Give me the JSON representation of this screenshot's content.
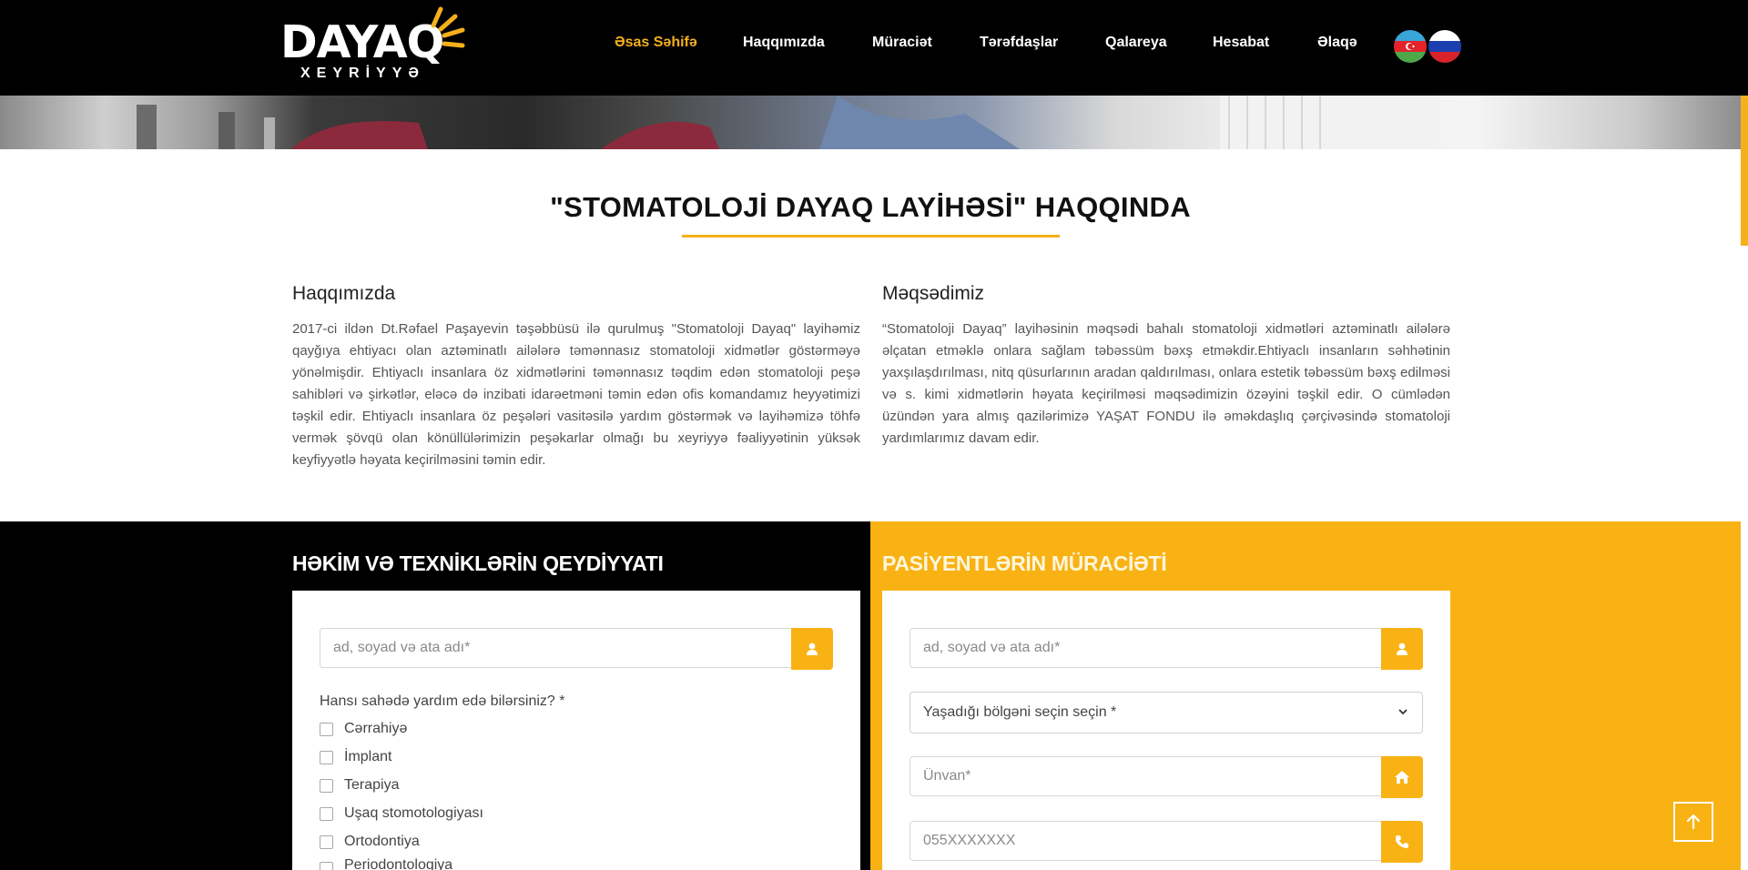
{
  "brand": {
    "name": "DAYAQ",
    "tagline": "XEYRİYYƏ",
    "accent_color": "#f5b01a"
  },
  "nav": {
    "items": [
      {
        "label": "Əsas Səhifə",
        "active": true
      },
      {
        "label": "Haqqımızda",
        "active": false
      },
      {
        "label": "Müraciət",
        "active": false
      },
      {
        "label": "Tərəfdaşlar",
        "active": false
      },
      {
        "label": "Qalareya",
        "active": false
      },
      {
        "label": "Hesabat",
        "active": false
      },
      {
        "label": "Əlaqə",
        "active": false
      }
    ],
    "languages": [
      {
        "icon": "azerbaijan-flag-icon"
      },
      {
        "icon": "russia-flag-icon"
      }
    ]
  },
  "about": {
    "title": "\"STOMATOLOJİ DAYAQ LAYİHƏSİ\" HAQQINDA",
    "left": {
      "heading": "Haqqımızda",
      "text": "2017-ci ildən Dt.Rəfael Paşayevin təşəbbüsü ilə qurulmuş \"Stomatoloji Dayaq\" layihəmiz qayğıya ehtiyacı olan aztəminatlı ailələrə təmənnasız stomatoloji xidmətlər göstərməyə yönəlmişdir. Ehtiyaclı insanlara öz xidmətlərini təmənnasız təqdim edən stomatoloji peşə sahibləri və şirkətlər, eləcə də inzibati idarəetməni təmin edən ofis komandamız heyyətimizi təşkil edir. Ehtiyaclı insanlara öz peşələri vasitəsilə yardım göstərmək və layihəmizə töhfə vermək şövqü olan könüllülərimizin peşəkarlar olmağı bu xeyriyyə fəaliyyətinin yüksək keyfiyyətlə həyata keçirilməsini təmin edir."
    },
    "right": {
      "heading": "Məqsədimiz",
      "text": "“Stomatoloji Dayaq” layihəsinin məqsədi bahalı stomatoloji xidmətləri aztəminatlı ailələrə əlçatan etməklə onlara sağlam təbəssüm bəxş etməkdir.Ehtiyaclı insanların səhhətinin yaxşılaşdırılması, nitq qüsurlarının aradan qaldırılması, onlara estetik təbəssüm bəxş edilməsi və s. kimi xidmətlərin həyata keçirilməsi məqsədimizin özəyini təşkil edir. O cümlədən üzündən yara almış qazilərimizə YAŞAT FONDU ilə əməkdaşlıq çərçivəsində stomatoloji yardımlarımız davam edir."
    }
  },
  "doctor_form": {
    "title": "HƏKİM VƏ TEXNİKLƏRİN QEYDİYYATI",
    "name_placeholder": "ad, soyad və ata adı*",
    "question": "Hansı sahədə yardım edə bilərsiniz? *",
    "options": [
      "Cərrahiyə",
      "İmplant",
      "Terapiya",
      "Uşaq stomotologiyası",
      "Ortodontiya",
      "Periodontologiya"
    ]
  },
  "patient_form": {
    "title": "PASİYENTLƏRİN MÜRACİƏTİ",
    "name_placeholder": "ad, soyad və ata adı*",
    "region_select": "Yaşadığı bölgəni seçin seçin *",
    "address_placeholder": "Ünvan*",
    "phone_placeholder": "055XXXXXXX"
  },
  "icons": {
    "user": "user-icon",
    "home": "home-icon",
    "phone": "phone-icon",
    "chevron": "chevron-down-icon",
    "to_top": "arrow-up-icon"
  },
  "colors": {
    "header_bg": "#000000",
    "yellow_panel": "#f9b214",
    "dark_panel": "#000000"
  }
}
